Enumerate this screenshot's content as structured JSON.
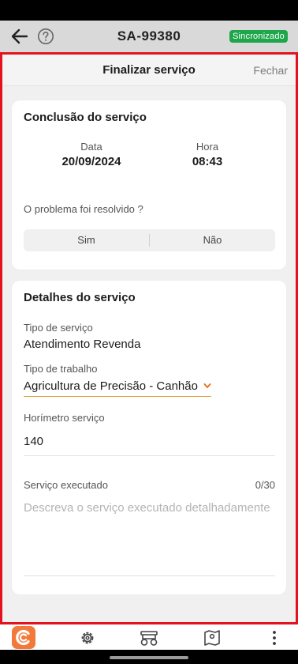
{
  "header": {
    "title": "SA-99380",
    "sync_badge": "Sincronizado",
    "back_icon": "arrow-left-icon",
    "help_icon": "help-circle-icon"
  },
  "modal": {
    "title": "Finalizar serviço",
    "close_label": "Fechar"
  },
  "conclusion": {
    "title": "Conclusão do serviço",
    "date_label": "Data",
    "date_value": "20/09/2024",
    "time_label": "Hora",
    "time_value": "08:43",
    "question": "O problema foi resolvido ?",
    "options": [
      "Sim",
      "Não"
    ]
  },
  "details": {
    "title": "Detalhes do serviço",
    "service_type_label": "Tipo de serviço",
    "service_type_value": "Atendimento Revenda",
    "work_type_label": "Tipo de trabalho",
    "work_type_value": "Agricultura de Precisão - Canhão",
    "hourmeter_label": "Horímetro serviço",
    "hourmeter_value": "140",
    "executed_label": "Serviço executado",
    "executed_counter": "0/30",
    "executed_placeholder": "Descreva o serviço executado detalhadamente"
  },
  "bottom_nav": {
    "items": [
      "app-logo-icon",
      "settings-gear-icon",
      "tractor-icon",
      "map-pin-icon",
      "more-vertical-icon"
    ]
  },
  "colors": {
    "accent_orange": "#f2793a",
    "sync_green": "#1ea64a",
    "highlight_red": "#e2131f"
  }
}
